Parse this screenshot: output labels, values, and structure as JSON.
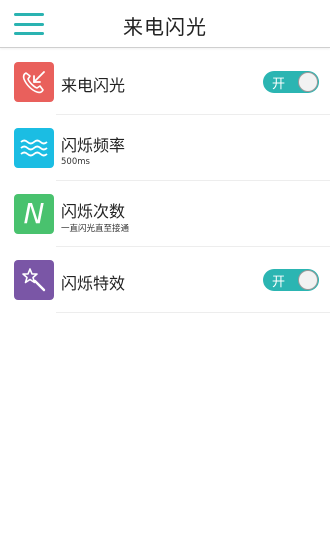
{
  "header": {
    "title": "来电闪光",
    "menu_icon": "hamburger-menu-icon",
    "accent": "#2ab3b1"
  },
  "items": [
    {
      "label": "来电闪光",
      "icon": "phone-incoming-icon",
      "icon_color": "#e9605c",
      "toggle": "开",
      "toggle_on": true
    },
    {
      "label": "闪烁频率",
      "sub": "500ms",
      "icon": "waves-icon",
      "icon_color": "#1bbde3"
    },
    {
      "label": "闪烁次数",
      "sub": "一直闪光直至接通",
      "icon": "letter-n-icon",
      "icon_letter": "N",
      "icon_color": "#49c26e"
    },
    {
      "label": "闪烁特效",
      "icon": "magic-wand-icon",
      "icon_color": "#7a56a6",
      "toggle": "开",
      "toggle_on": true
    }
  ]
}
